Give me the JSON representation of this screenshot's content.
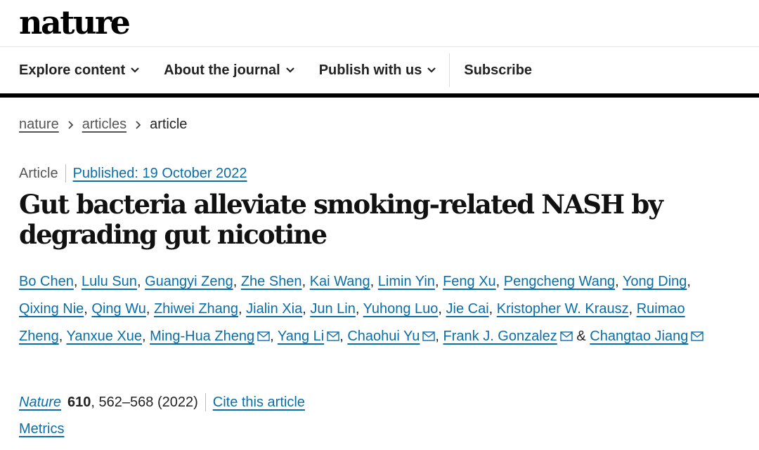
{
  "header": {
    "logo": "nature"
  },
  "nav": {
    "items": [
      {
        "label": "Explore content",
        "icon": "chevron-down-icon"
      },
      {
        "label": "About the journal",
        "icon": "chevron-down-icon"
      },
      {
        "label": "Publish with us",
        "icon": "chevron-down-icon"
      }
    ],
    "subscribe": "Subscribe"
  },
  "breadcrumb": {
    "items": [
      "nature",
      "articles"
    ],
    "current": "article",
    "separator_icon": "chevron-right-icon"
  },
  "article": {
    "type": "Article",
    "published": "Published: 19 October 2022",
    "title": "Gut bacteria alleviate smoking-related NASH by degrading gut nicotine",
    "authors": [
      {
        "name": "Bo Chen",
        "mail": false
      },
      {
        "name": "Lulu Sun",
        "mail": false
      },
      {
        "name": "Guangyi Zeng",
        "mail": false
      },
      {
        "name": "Zhe Shen",
        "mail": false
      },
      {
        "name": "Kai Wang",
        "mail": false
      },
      {
        "name": "Limin Yin",
        "mail": false
      },
      {
        "name": "Feng Xu",
        "mail": false
      },
      {
        "name": "Pengcheng Wang",
        "mail": false
      },
      {
        "name": "Yong Ding",
        "mail": false
      },
      {
        "name": "Qixing Nie",
        "mail": false
      },
      {
        "name": "Qing Wu",
        "mail": false
      },
      {
        "name": "Zhiwei Zhang",
        "mail": false
      },
      {
        "name": "Jialin Xia",
        "mail": false
      },
      {
        "name": "Jun Lin",
        "mail": false
      },
      {
        "name": "Yuhong Luo",
        "mail": false
      },
      {
        "name": "Jie Cai",
        "mail": false
      },
      {
        "name": "Kristopher W. Krausz",
        "mail": false
      },
      {
        "name": "Ruimao Zheng",
        "mail": false
      },
      {
        "name": "Yanxue Xue",
        "mail": false
      },
      {
        "name": "Ming-Hua Zheng",
        "mail": true
      },
      {
        "name": "Yang Li",
        "mail": true
      },
      {
        "name": "Chaohui Yu",
        "mail": true
      },
      {
        "name": "Frank J. Gonzalez",
        "mail": true
      },
      {
        "name": "Changtao Jiang",
        "mail": true
      }
    ],
    "mail_icon": "envelope-icon",
    "author_joiner": "&",
    "citation": {
      "journal": "Nature",
      "volume": "610",
      "pages": ", 562–568 (2022)",
      "cite_link": "Cite this article"
    },
    "metrics_link": "Metrics"
  },
  "colors": {
    "link": "#0a6ea8",
    "text": "#222222",
    "nav_rule": "#000000"
  }
}
